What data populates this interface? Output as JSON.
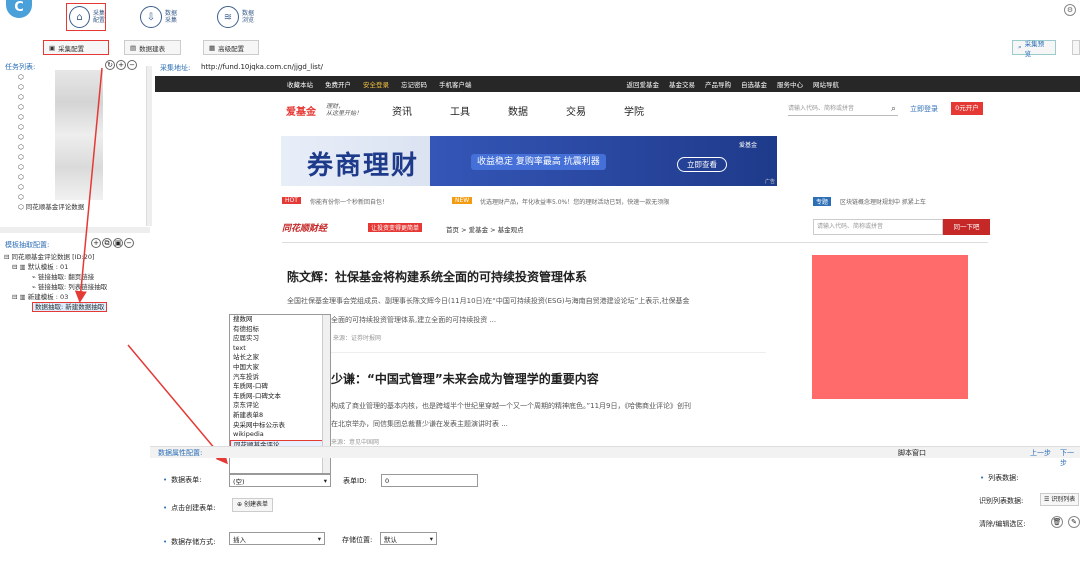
{
  "logo_text": "C",
  "nav": [
    {
      "label": "采集\n配置",
      "icon": "⌂"
    },
    {
      "label": "数据\n采集",
      "icon": "⇩"
    },
    {
      "label": "数据\n浏览",
      "icon": "≋"
    }
  ],
  "subtoolbar": [
    {
      "label": "采集配置",
      "icon": "▣"
    },
    {
      "label": "数据建表",
      "icon": "▤"
    },
    {
      "label": "高级配置",
      "icon": "▦"
    }
  ],
  "preview_button": "采集预览",
  "task_list_label": "任务列表:",
  "task_items": [
    "同花顺基金评论数据"
  ],
  "collect_url_label": "采集地址:",
  "collect_url": "http://fund.10jqka.com.cn/jjgd_list/",
  "template_label": "模板抽取配置:",
  "template_tree": [
    "同花顺基金评论数据 [ID:20]",
    "默认模板 : 01",
    "链接抽取: 翻页链接",
    "链接抽取: 列表链接抽取",
    "新建模板 : 03",
    "数据抽取: 新建数据抽取"
  ],
  "site": {
    "topbar": [
      "收藏本站",
      "免费开户",
      "安全登录",
      "忘记密码",
      "手机客户端",
      "返回爱基金",
      "基金交易",
      "产品导购",
      "自选基金",
      "服务中心",
      "网站导航"
    ],
    "brand": "爱基金",
    "slogan": "理财，\n从这里开始！",
    "menu": [
      "资讯",
      "工具",
      "数据",
      "交易",
      "学院"
    ],
    "search_placeholder": "请输入代码、简称或拼音",
    "login": "立即登录",
    "open": "0元开户",
    "banner_title": "券商理财",
    "banner_sub": "收益稳定 复购率最高 抗震利器",
    "banner_btn": "立即查看",
    "banner_tag": "爱基金",
    "banner_ad": "广告",
    "hot_badge": "HOT",
    "hot_text": "你能有份你一个秒新回自包！",
    "new_badge": "NEW",
    "new_text": "优选理财产品，年化收益率5.0%！您的理财活动已到，快速一款无须限",
    "topic_badge": "专题",
    "topic_text": "区块链概念理财规划中 抓紧上车",
    "section_logo": "同花顺财经",
    "section_tag": "让投资变得更简单",
    "crumb": "首页 > 爱基金 > 基金观点",
    "search2_placeholder": "请输入代码、简称或拼音",
    "search2_btn": "同一下吧",
    "a1_title": "陈文辉：社保基金将构建系统全面的可持续投资管理体系",
    "a1_body1": "全国社保基金理事会党组成员、副理事长陈文辉今日(11月10日)在“中国可持续投资(ESG)与海南自贸港建设论坛”上表示,社保基金",
    "a1_body2": "全面的可持续投资管理体系,建立全面的可持续投资 ...",
    "a1_src": "来源：证券时报网",
    "a2_title": "少谦：“中国式管理”未来会成为管理学的重要内容",
    "a2_body1": "构成了商业管理的基本内核，也是跨域半个世纪里穿越一个又一个周期的精神底色。”11月9日，《哈佛商业评论》创刊",
    "a2_body2": "在北京举办，同信集团总裁曹少谦在发表主题演讲时表 ...",
    "a2_src": "来源：意见中国网"
  },
  "dropdown_items": [
    "搜数网",
    "有德招标",
    "应届实习",
    "text",
    "站长之家",
    "中国大家",
    "汽车投诉",
    "车质网-口碑",
    "车质网-口碑文本",
    "京东评论",
    "新建表单8",
    "央采网中标公示表",
    "wikipedia",
    "同花顺基金评论"
  ],
  "props": {
    "label": "数据属性配置:",
    "script_window": "脚本窗口",
    "prev": "上一步",
    "next": "下一步",
    "form_label": "数据表单:",
    "form_value": "(空)",
    "form_id_label": "表单ID:",
    "form_id_value": "0",
    "create_label": "点击创建表单:",
    "create_btn": "创建表单",
    "store_label": "数据存储方式:",
    "store_value": "插入",
    "store_pos_label": "存储位置:",
    "store_pos_value": "默认",
    "list_data_label": "列表数据:",
    "list_data_sub": "识别列表数据:",
    "list_data_btn": "识别列表",
    "clear_label": "清除/编辑选区:"
  },
  "colors": {
    "accent": "#2d6fb7",
    "red": "#e53935",
    "sitebar": "#272727",
    "banner": "#1e3a8a"
  }
}
